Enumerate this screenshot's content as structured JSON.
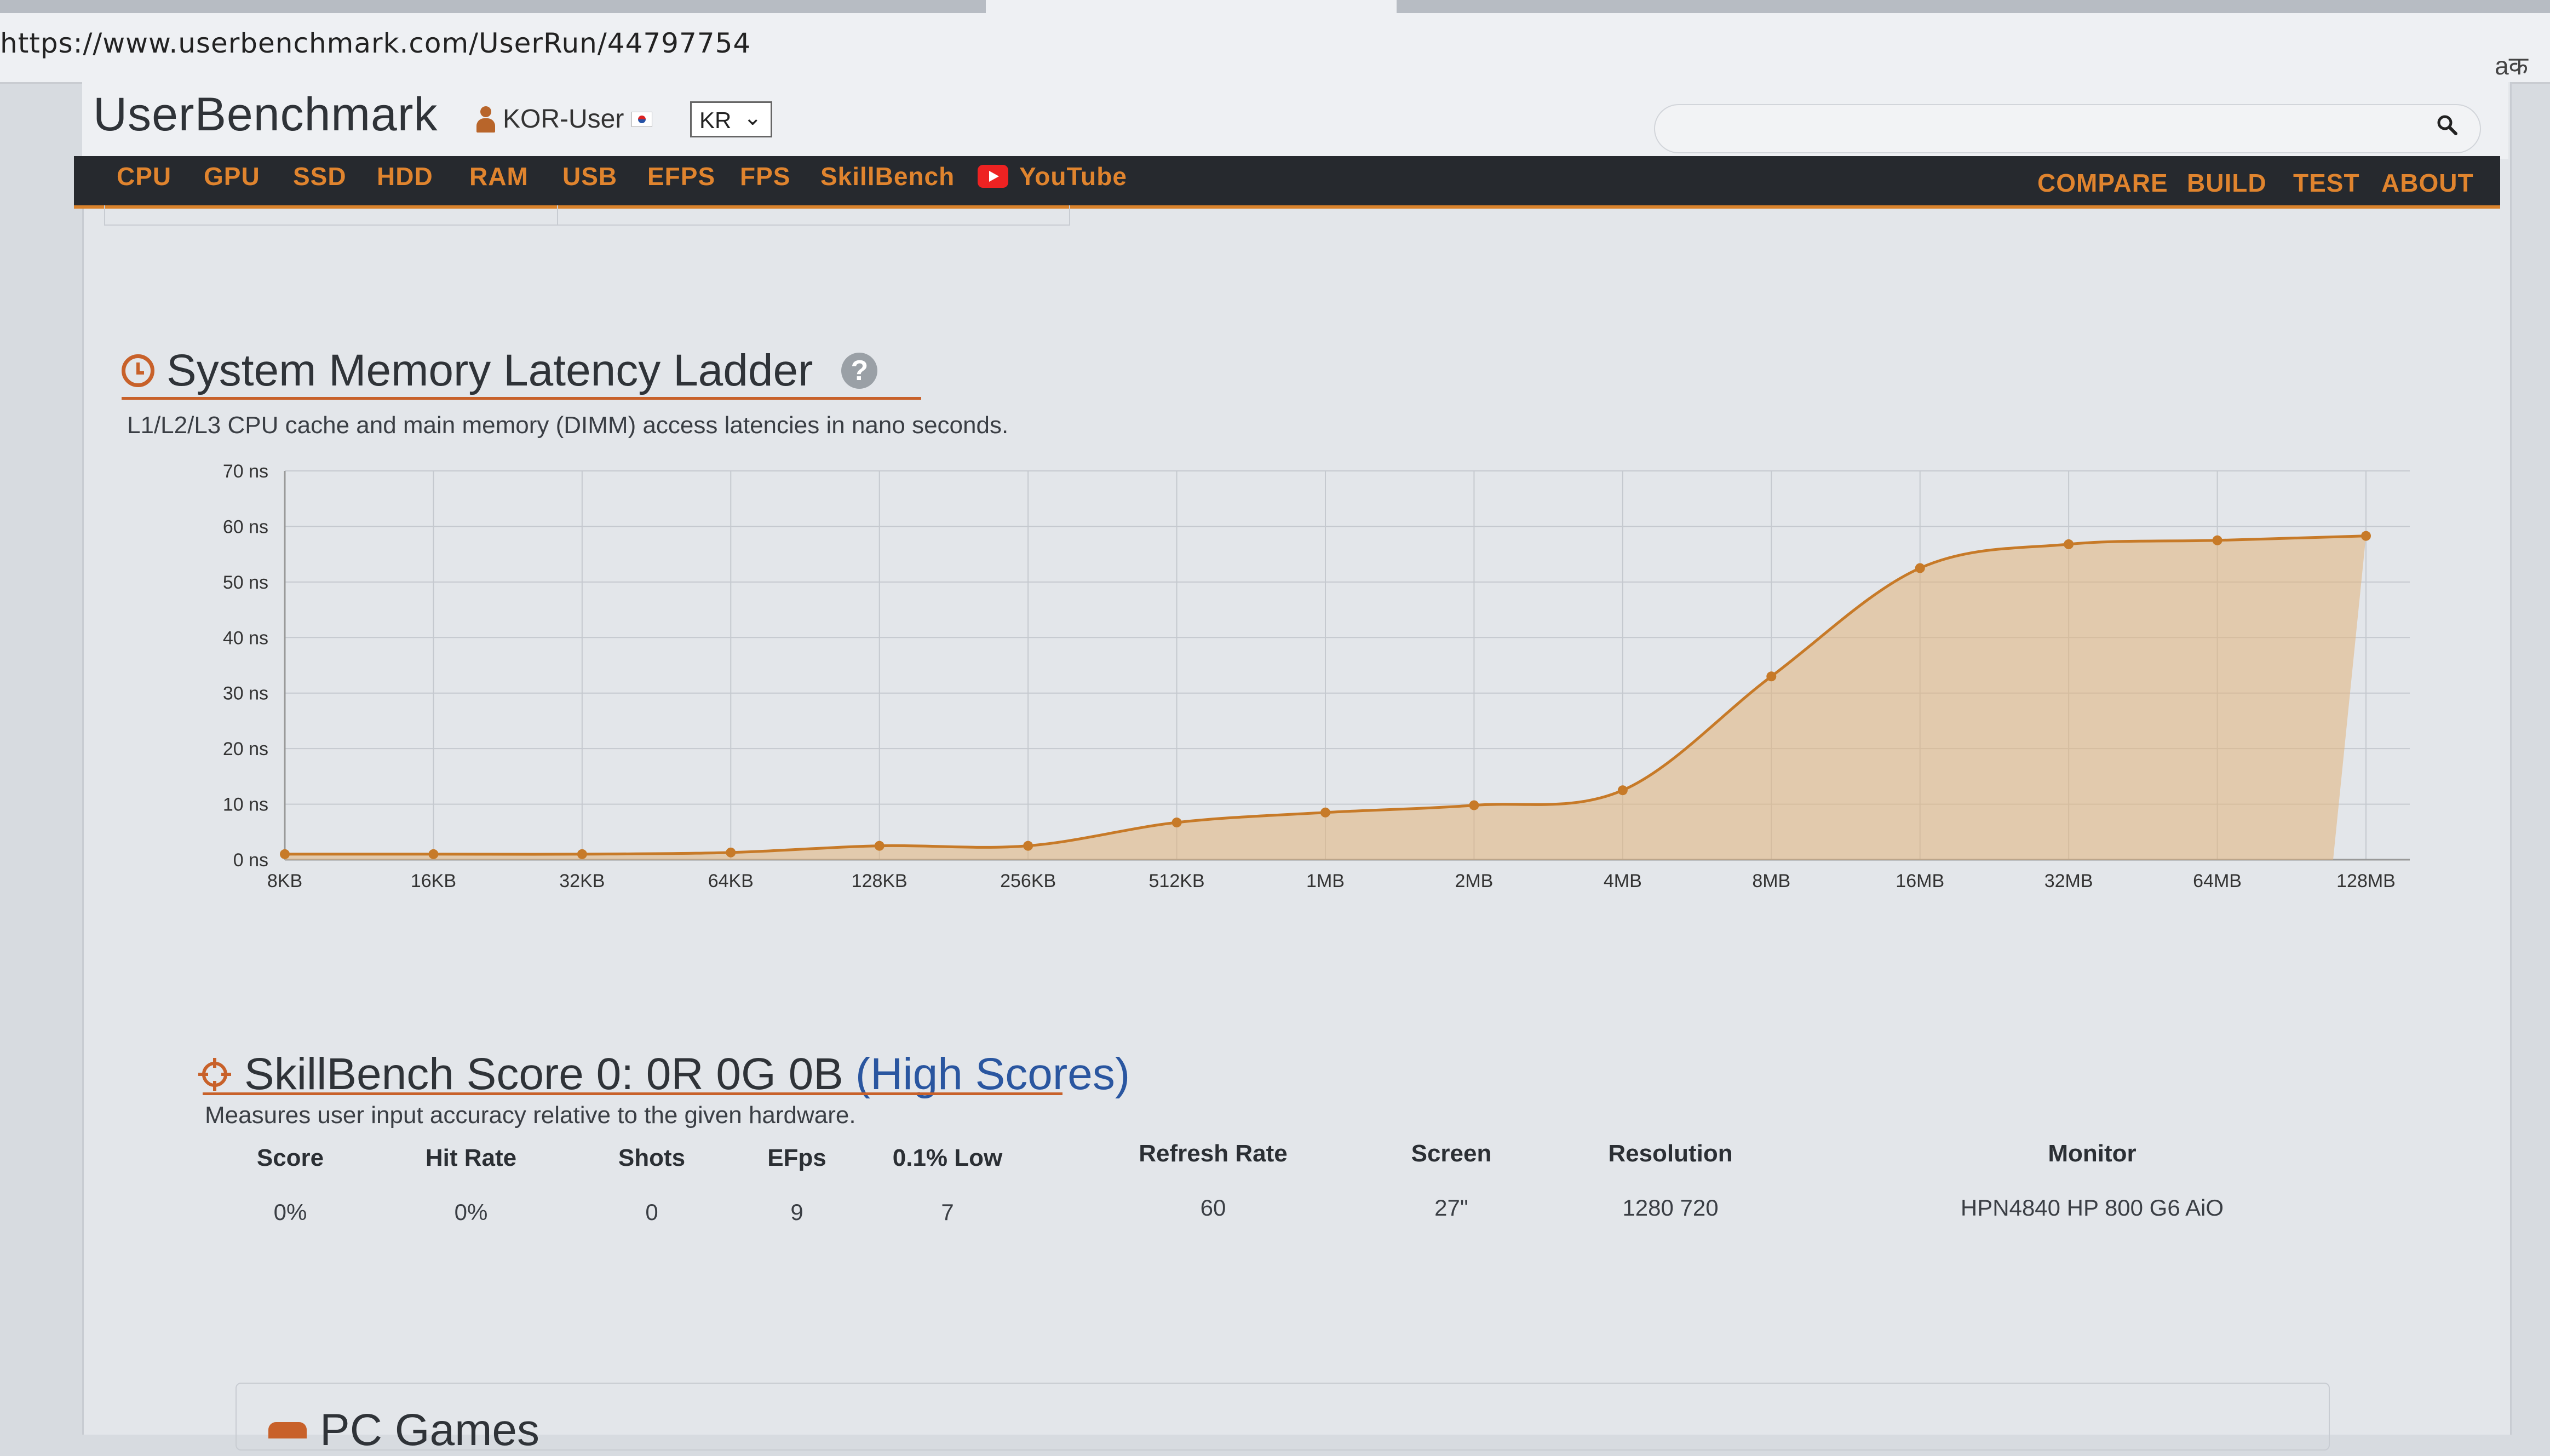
{
  "browser": {
    "url": "https://www.userbenchmark.com/UserRun/44797754",
    "translate_icon": "translate-icon"
  },
  "header": {
    "brand": "UserBenchmark",
    "user_name": "KOR-User",
    "lang_selected": "KR"
  },
  "nav": {
    "left": [
      "CPU",
      "GPU",
      "SSD",
      "HDD",
      "RAM",
      "USB",
      "EFPS",
      "FPS",
      "SkillBench"
    ],
    "youtube": "YouTube",
    "right": [
      "COMPARE",
      "BUILD",
      "TEST",
      "ABOUT"
    ]
  },
  "latency": {
    "title": "System Memory Latency Ladder",
    "help": "?",
    "subtitle": "L1/L2/L3 CPU cache and main memory (DIMM) access latencies in nano seconds."
  },
  "chart_data": {
    "type": "area",
    "categories": [
      "8KB",
      "16KB",
      "32KB",
      "64KB",
      "128KB",
      "256KB",
      "512KB",
      "1MB",
      "2MB",
      "4MB",
      "8MB",
      "16MB",
      "32MB",
      "64MB",
      "128MB"
    ],
    "values": [
      1.0,
      1.0,
      1.0,
      1.3,
      2.5,
      2.5,
      6.7,
      8.5,
      9.8,
      12.5,
      33.0,
      52.5,
      56.8,
      57.5,
      58.3
    ],
    "yticks": [
      "0 ns",
      "10 ns",
      "20 ns",
      "30 ns",
      "40 ns",
      "50 ns",
      "60 ns",
      "70 ns"
    ],
    "ylim": [
      0,
      70
    ],
    "grid": true,
    "colors": {
      "line": "#c77a28",
      "fill": "#e2b27a",
      "grid": "#c5c9cf"
    }
  },
  "skillbench": {
    "title_prefix": "SkillBench Score 0: 0R 0G 0B",
    "link": "(High Scores)",
    "subtitle": "Measures user input accuracy relative to the given hardware.",
    "columns": [
      {
        "head": "Score",
        "value": "0%"
      },
      {
        "head": "Hit Rate",
        "value": "0%"
      },
      {
        "head": "Shots",
        "value": "0"
      },
      {
        "head": "EFps",
        "value": "9"
      },
      {
        "head": "0.1% Low",
        "value": "7"
      },
      {
        "head": "Refresh Rate",
        "value": "60"
      },
      {
        "head": "Screen",
        "value": "27\""
      },
      {
        "head": "Resolution",
        "value": "1280 720"
      },
      {
        "head": "Monitor",
        "value": "HPN4840 HP 800 G6 AiO"
      }
    ]
  },
  "pcgames": {
    "title": "PC Games"
  },
  "colors": {
    "accent": "#d9822b",
    "nav_bg": "#26292e",
    "link": "#2a56a0"
  }
}
